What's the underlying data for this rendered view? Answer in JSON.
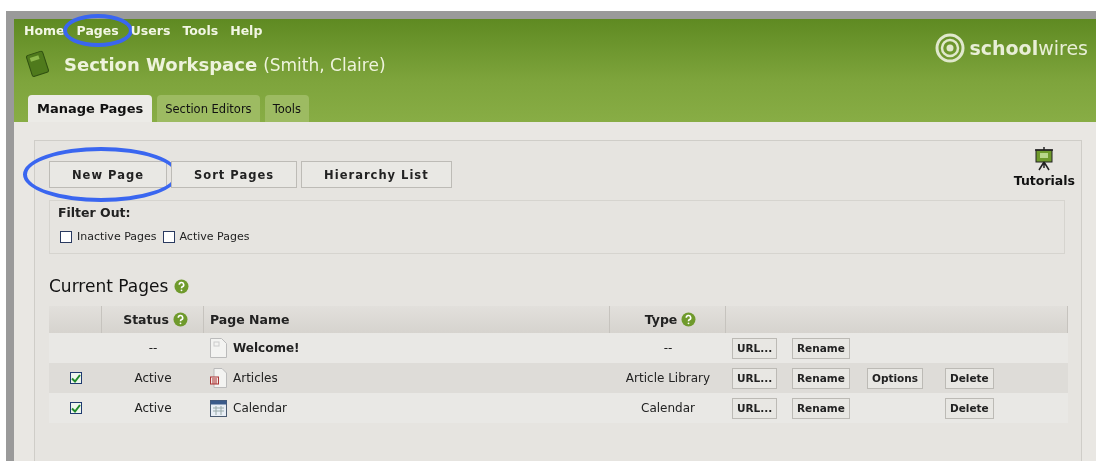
{
  "menu": [
    {
      "label": "Home",
      "highlighted": false
    },
    {
      "label": "Pages",
      "highlighted": true
    },
    {
      "label": "Users",
      "highlighted": false
    },
    {
      "label": "Tools",
      "highlighted": false
    },
    {
      "label": "Help",
      "highlighted": false
    }
  ],
  "logo": {
    "bold": "school",
    "light": "wires"
  },
  "title": {
    "main": "Section Workspace",
    "user": "(Smith, Claire)"
  },
  "tabs": [
    {
      "label": "Manage Pages",
      "selected": true
    },
    {
      "label": "Section Editors",
      "selected": false
    },
    {
      "label": "Tools",
      "selected": false
    }
  ],
  "buttons": [
    {
      "label": "New Page",
      "highlighted": true
    },
    {
      "label": "Sort Pages",
      "highlighted": false
    },
    {
      "label": "Hierarchy List",
      "highlighted": false
    }
  ],
  "tutorials": "Tutorials",
  "filter": {
    "legend": "Filter Out:",
    "options": [
      {
        "label": "Inactive Pages",
        "checked": false
      },
      {
        "label": "Active Pages",
        "checked": false
      }
    ]
  },
  "current_pages": {
    "heading": "Current Pages",
    "columns": [
      {
        "label": "Status",
        "help": true
      },
      {
        "label": "Page Name",
        "help": false
      },
      {
        "label": "Type",
        "help": true
      }
    ],
    "rows": [
      {
        "status": "--",
        "name": "Welcome!",
        "bold": true,
        "type": "--",
        "actions": {
          "url": "URL...",
          "rename": "Rename"
        }
      },
      {
        "checked": true,
        "status": "Active",
        "name": "Articles",
        "bold": false,
        "type": "Article Library",
        "actions": {
          "url": "URL...",
          "rename": "Rename",
          "options": "Options",
          "delete": "Delete"
        }
      },
      {
        "checked": true,
        "status": "Active",
        "name": "Calendar",
        "bold": false,
        "type": "Calendar",
        "actions": {
          "url": "URL...",
          "rename": "Rename",
          "delete": "Delete"
        }
      }
    ]
  }
}
